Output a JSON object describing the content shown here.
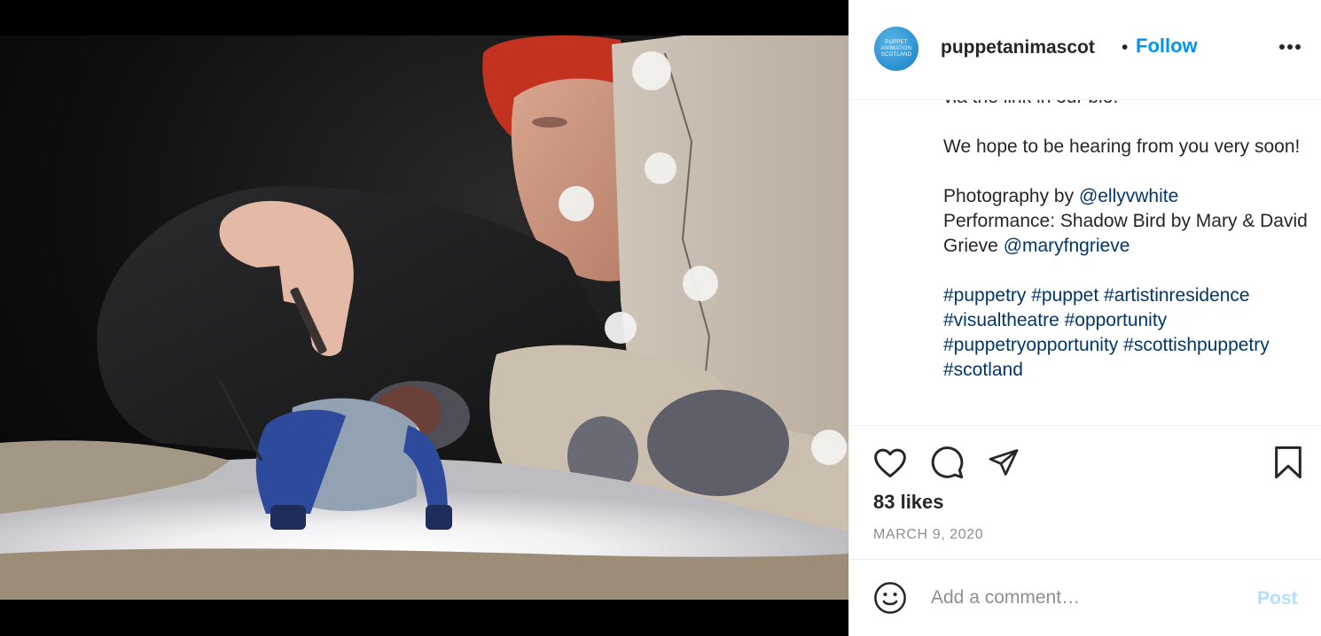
{
  "post": {
    "image_alt": "Puppeteer animating a knitted puppet over a lit paper landscape",
    "account": {
      "username": "puppetanimascot",
      "avatar_lines": [
        "PUPPET",
        "ANIMATION",
        "SCOTLAND"
      ],
      "separator": "•",
      "follow_label": "Follow"
    },
    "caption": {
      "partial_first_line": "via the link in our bio.",
      "line_hope": "We hope to be hearing from you very soon!",
      "photography_prefix": "Photography by ",
      "photography_handle": "@ellyvwhite",
      "performance_text": "Performance: Shadow Bird by Mary & David Grieve ",
      "performance_handle": "@maryfngrieve",
      "hashtags": [
        "#puppetry",
        "#puppet",
        "#artistinresidence",
        "#visualtheatre",
        "#opportunity",
        "#puppetryopportunity",
        "#scottishpuppetry",
        "#scotland"
      ]
    },
    "likes_text": "83 likes",
    "date_text": "MARCH 9, 2020",
    "comment": {
      "placeholder": "Add a comment…",
      "post_label": "Post"
    },
    "icons": {
      "more": "more-options-icon",
      "like": "heart-icon",
      "comment": "comment-bubble-icon",
      "share": "paper-plane-icon",
      "save": "bookmark-icon",
      "emoji": "emoji-smiley-icon"
    },
    "colors": {
      "follow": "#0095f6",
      "link": "#00376b",
      "post_disabled": "#b2dffc",
      "text": "#262626",
      "muted": "#8e8e8e"
    }
  }
}
